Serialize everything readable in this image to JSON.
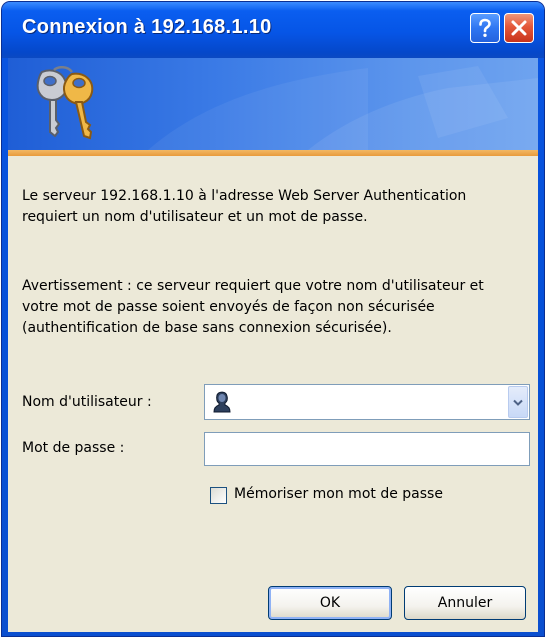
{
  "window": {
    "title": "Connexion à 192.168.1.10"
  },
  "titlebar": {
    "help_icon": "question-mark-icon",
    "close_icon": "close-x-icon"
  },
  "banner": {
    "icon": "keys-icon"
  },
  "message": {
    "line1": "Le serveur 192.168.1.10 à l'adresse Web Server Authentication requiert un nom d'utilisateur et un mot de passe.",
    "line2": "Avertissement : ce serveur requiert que votre nom d'utilisateur et votre mot de passe soient envoyés de façon non sécurisée (authentification de base sans connexion sécurisée)."
  },
  "form": {
    "username_label": "Nom d'utilisateur :",
    "username_value": "",
    "username_icon": "user-icon",
    "password_label": "Mot de passe :",
    "password_value": "",
    "remember_label": "Mémoriser mon mot de passe",
    "remember_checked": false
  },
  "buttons": {
    "ok_label": "OK",
    "cancel_label": "Annuler"
  },
  "colors": {
    "titlebar": "#0655e6",
    "dialog_bg": "#ece9d8",
    "banner_rule": "#e89b3c",
    "close_button": "#e4583a"
  }
}
